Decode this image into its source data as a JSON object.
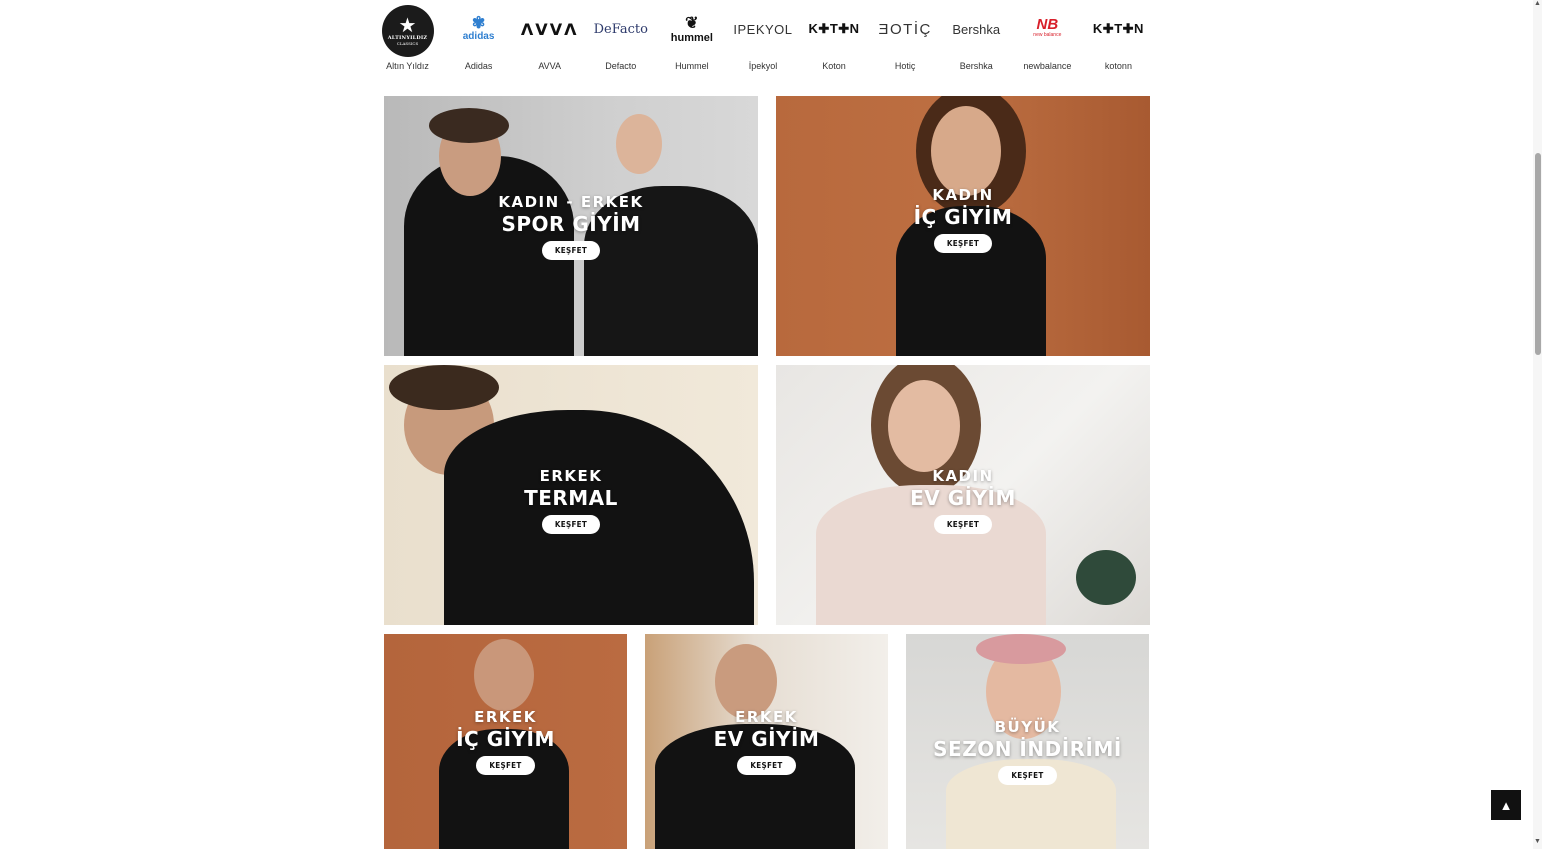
{
  "brands": [
    {
      "name": "Altın Yıldız",
      "logo_line1": "ALTINYILDIZ",
      "logo_line2": "CLASSICS",
      "icon": "star-icon"
    },
    {
      "name": "Adidas",
      "logo": "adidas",
      "icon": "trefoil-icon"
    },
    {
      "name": "AVVA",
      "logo": "ΛVVΛ"
    },
    {
      "name": "Defacto",
      "logo": "DeFacto"
    },
    {
      "name": "Hummel",
      "logo": "hummel",
      "icon": "bee-icon"
    },
    {
      "name": "İpekyol",
      "logo": "IPEKYOL"
    },
    {
      "name": "Koton",
      "logo": "K✚T✚N"
    },
    {
      "name": "Hotiç",
      "logo": "ƎOTİÇ"
    },
    {
      "name": "Bershka",
      "logo": "Bershka"
    },
    {
      "name": "newbalance",
      "logo": "NB",
      "logo_sub": "new balance"
    },
    {
      "name": "kotonn",
      "logo": "K✚T✚N"
    }
  ],
  "banners": {
    "spor": {
      "top": "KADIN - ERKEK",
      "main": "SPOR GİYİM",
      "cta": "KEŞFET"
    },
    "kadin_ic": {
      "top": "KADIN",
      "main": "İÇ GİYİM",
      "cta": "KEŞFET"
    },
    "termal": {
      "top": "ERKEK",
      "main": "TERMAL",
      "cta": "KEŞFET"
    },
    "kadin_ev": {
      "top": "KADIN",
      "main": "EV GİYİM",
      "cta": "KEŞFET"
    },
    "erkek_ic": {
      "top": "ERKEK",
      "main": "İÇ GİYİM",
      "cta": "KEŞFET"
    },
    "erkek_ev": {
      "top": "ERKEK",
      "main": "EV GİYİM",
      "cta": "KEŞFET"
    },
    "sezon": {
      "top": "BÜYÜK",
      "main": "SEZON İNDİRİMİ",
      "cta": "KEŞFET"
    }
  },
  "colors": {
    "accent": "#111111",
    "orange_bg": "#b5643a",
    "grey_bg": "#c9c9c9",
    "cream_bg": "#efe6d6",
    "nb_red": "#d81f2a",
    "adidas_blue": "#2f7fd0"
  },
  "scroll_top_icon": "chevron-up-icon"
}
